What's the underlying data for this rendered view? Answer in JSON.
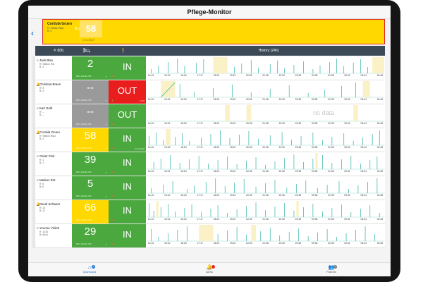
{
  "app": {
    "title": "Pflege-Monitor"
  },
  "alert": {
    "name": "Cordula Gruen",
    "room": "R: Station Blau",
    "bed": "B: 4",
    "value": "58",
    "time": "⊙ 14:50:27"
  },
  "header": {
    "patient_label": "≗ 8(8)",
    "bed_icon": "🛏",
    "walk_icon": "🚶",
    "history_label": "History (24h)"
  },
  "colors": {
    "green": "#4aa83e",
    "yellow": "#ffd800",
    "gray": "#9a9a9a",
    "red": "#ea1d1d",
    "line": "#2fb3a3",
    "out_band": "#fbf1c7"
  },
  "time_ticks": [
    "14:10",
    "15:12",
    "16:15",
    "17:17",
    "18:20",
    "19:22",
    "20:25",
    "21:28",
    "22:30",
    "23:33",
    "00:36",
    "01:38",
    "02:41",
    "03:44",
    "04:46"
  ],
  "patients": [
    {
      "name": "Jack Blau",
      "room": "R: Station Rot",
      "bed": "B: 3",
      "bell": false,
      "value": "2",
      "value_caption": "MIN. SINCE. PMC",
      "tile": "green",
      "status": "IN",
      "status_color": "green",
      "status_note": "",
      "nodata": "",
      "history": {
        "out_segments": [
          [
            0.28,
            0.34
          ],
          [
            0.95,
            1.0
          ]
        ],
        "ramp": null,
        "spikes": [
          0.02,
          0.05,
          0.09,
          0.13,
          0.16,
          0.21,
          0.24,
          0.37,
          0.4,
          0.44,
          0.47,
          0.52,
          0.55,
          0.58,
          0.62,
          0.66,
          0.7,
          0.73,
          0.77,
          0.8,
          0.83,
          0.87,
          0.9,
          0.93
        ]
      }
    },
    {
      "name": "Christina Braun",
      "room": "R: 3",
      "bed": "B: 3",
      "bell": true,
      "value": "--",
      "value_caption": "MIN. SINCE. PMC",
      "tile": "gray",
      "status": "OUT",
      "status_color": "red",
      "status_note": "12:40",
      "nodata": "",
      "history": {
        "out_segments": [
          [
            0.06,
            0.12
          ],
          [
            0.91,
            0.94
          ]
        ],
        "ramp": [
          0.06,
          0.12
        ],
        "spikes": [
          0.14,
          0.2,
          0.28,
          0.36,
          0.44,
          0.52,
          0.6,
          0.68,
          0.75,
          0.82,
          0.88
        ]
      }
    },
    {
      "name": "Karl Gelb",
      "room": "R: --",
      "bed": "B: --",
      "bell": false,
      "value": "--",
      "value_caption": "MIN. SINCE. PMC",
      "tile": "gray",
      "status": "OUT",
      "status_color": "green",
      "status_note": "",
      "nodata": "no data",
      "history": {
        "out_segments": [
          [
            0.33,
            0.35
          ],
          [
            0.42,
            0.44
          ],
          [
            0.87,
            0.89
          ]
        ],
        "ramp": null,
        "spikes": []
      }
    },
    {
      "name": "Cordula Gruen",
      "room": "R: Station Blau",
      "bed": "B: 4",
      "bell": true,
      "value": "58",
      "value_caption": "MIN. SINCE. PMC",
      "tile": "yellow",
      "status": "IN",
      "status_color": "green",
      "status_note": "Complaints",
      "nodata": "",
      "history": {
        "out_segments": [
          [
            0.08,
            0.1
          ]
        ],
        "ramp": null,
        "spikes": [
          0.01,
          0.04,
          0.07,
          0.12,
          0.15,
          0.18,
          0.23,
          0.27,
          0.31,
          0.35,
          0.39,
          0.43,
          0.47,
          0.52,
          0.57,
          0.61,
          0.65,
          0.7,
          0.74,
          0.78,
          0.83,
          0.87,
          0.91,
          0.95,
          0.98
        ]
      }
    },
    {
      "name": "Oskar Pink",
      "room": "R: 1",
      "bed": "B: 1",
      "bell": false,
      "value": "39",
      "value_caption": "MIN. SINCE. PMC",
      "tile": "green",
      "status": "IN",
      "status_color": "green",
      "status_note": "",
      "nodata": "",
      "history": {
        "out_segments": [
          [
            0.71,
            0.72
          ]
        ],
        "ramp": null,
        "spikes": [
          0.03,
          0.06,
          0.1,
          0.14,
          0.18,
          0.22,
          0.26,
          0.3,
          0.34,
          0.38,
          0.42,
          0.46,
          0.5,
          0.54,
          0.58,
          0.62,
          0.66,
          0.7,
          0.74,
          0.78,
          0.82,
          0.86,
          0.9,
          0.94,
          0.97
        ]
      }
    },
    {
      "name": "Markus Rot",
      "room": "R: 6",
      "bed": "B: 6",
      "bell": false,
      "value": "5",
      "value_caption": "MIN. SINCE. PMC",
      "tile": "green",
      "status": "IN",
      "status_color": "green",
      "status_note": "",
      "nodata": "",
      "history": {
        "out_segments": [],
        "ramp": null,
        "spikes": [
          0.02,
          0.07,
          0.11,
          0.17,
          0.2,
          0.25,
          0.29,
          0.33,
          0.37,
          0.41,
          0.46,
          0.5,
          0.54,
          0.59,
          0.63,
          0.67,
          0.72,
          0.76,
          0.81,
          0.85,
          0.89,
          0.93,
          0.97
        ]
      }
    },
    {
      "name": "David Schwarz",
      "room": "R: 12",
      "bed": "B: 12",
      "bell": true,
      "value": "66",
      "value_caption": "MIN. SINCE. PMC",
      "tile": "yellow",
      "status": "IN",
      "status_color": "green",
      "status_note": "",
      "nodata": "",
      "history": {
        "out_segments": [
          [
            0.04,
            0.05
          ],
          [
            0.63,
            0.64
          ]
        ],
        "ramp": null,
        "spikes": [
          0.01,
          0.03,
          0.06,
          0.09,
          0.12,
          0.16,
          0.19,
          0.23,
          0.27,
          0.3,
          0.34,
          0.38,
          0.42,
          0.46,
          0.5,
          0.54,
          0.58,
          0.62,
          0.66,
          0.7,
          0.74,
          0.78,
          0.82,
          0.86,
          0.9,
          0.94,
          0.98
        ]
      }
    },
    {
      "name": "Yvonne Violett",
      "room": "R: 1234",
      "bed": "B: Abcd",
      "bell": false,
      "value": "29",
      "value_caption": "MIN. SINCE. PMC",
      "tile": "green",
      "status": "IN",
      "status_color": "green",
      "status_note": "",
      "nodata": "",
      "history": {
        "out_segments": [
          [
            0.22,
            0.28
          ],
          [
            0.44,
            0.46
          ]
        ],
        "ramp": null,
        "spikes": [
          0.02,
          0.05,
          0.09,
          0.13,
          0.17,
          0.3,
          0.34,
          0.38,
          0.42,
          0.48,
          0.52,
          0.56,
          0.6,
          0.64,
          0.68,
          0.72,
          0.76,
          0.8,
          0.84,
          0.88,
          0.92,
          0.96
        ]
      }
    }
  ],
  "bottom_nav": [
    {
      "label": "Dashboard",
      "icon": "home-icon",
      "glyph": "⌂",
      "badge": "1",
      "badge_color": "#2a7ad6",
      "active": true
    },
    {
      "label": "Alerts",
      "icon": "bell-icon",
      "glyph": "🔔",
      "badge": "",
      "badge_color": "#e12a2a",
      "active": false
    },
    {
      "label": "Patients",
      "icon": "people-icon",
      "glyph": "👥",
      "badge": "8",
      "badge_color": "#777777",
      "active": false
    }
  ]
}
